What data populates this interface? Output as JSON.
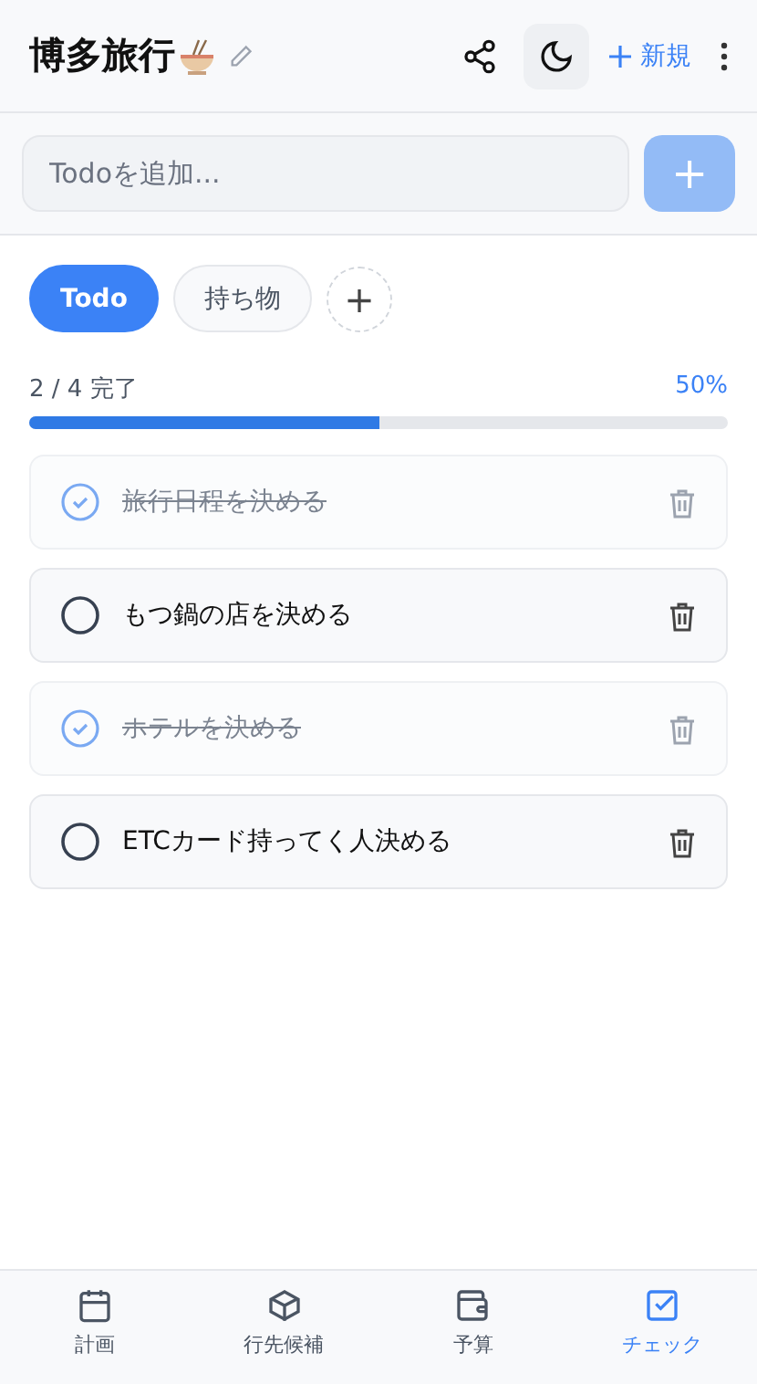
{
  "header": {
    "title": "博多旅行",
    "new_label": "新規"
  },
  "add_todo": {
    "placeholder": "Todoを追加...",
    "button": "+"
  },
  "lists": [
    {
      "label": "Todo",
      "selected": true
    },
    {
      "label": "持ち物",
      "selected": false
    }
  ],
  "add_list_button": "+",
  "progress": {
    "summary": "2 / 4 完了",
    "percent": "50%",
    "level": 0.5
  },
  "todos": [
    {
      "text": "旅行日程を決める",
      "checked": true
    },
    {
      "text": "もつ鍋の店を決める",
      "checked": false
    },
    {
      "text": "ホテルを決める",
      "checked": true
    },
    {
      "text": "ETCカード持ってく人決める",
      "checked": false
    }
  ],
  "nav": [
    {
      "label": "計画",
      "selected": false
    },
    {
      "label": "行先候補",
      "selected": false
    },
    {
      "label": "予算",
      "selected": false
    },
    {
      "label": "チェック",
      "selected": true
    }
  ]
}
